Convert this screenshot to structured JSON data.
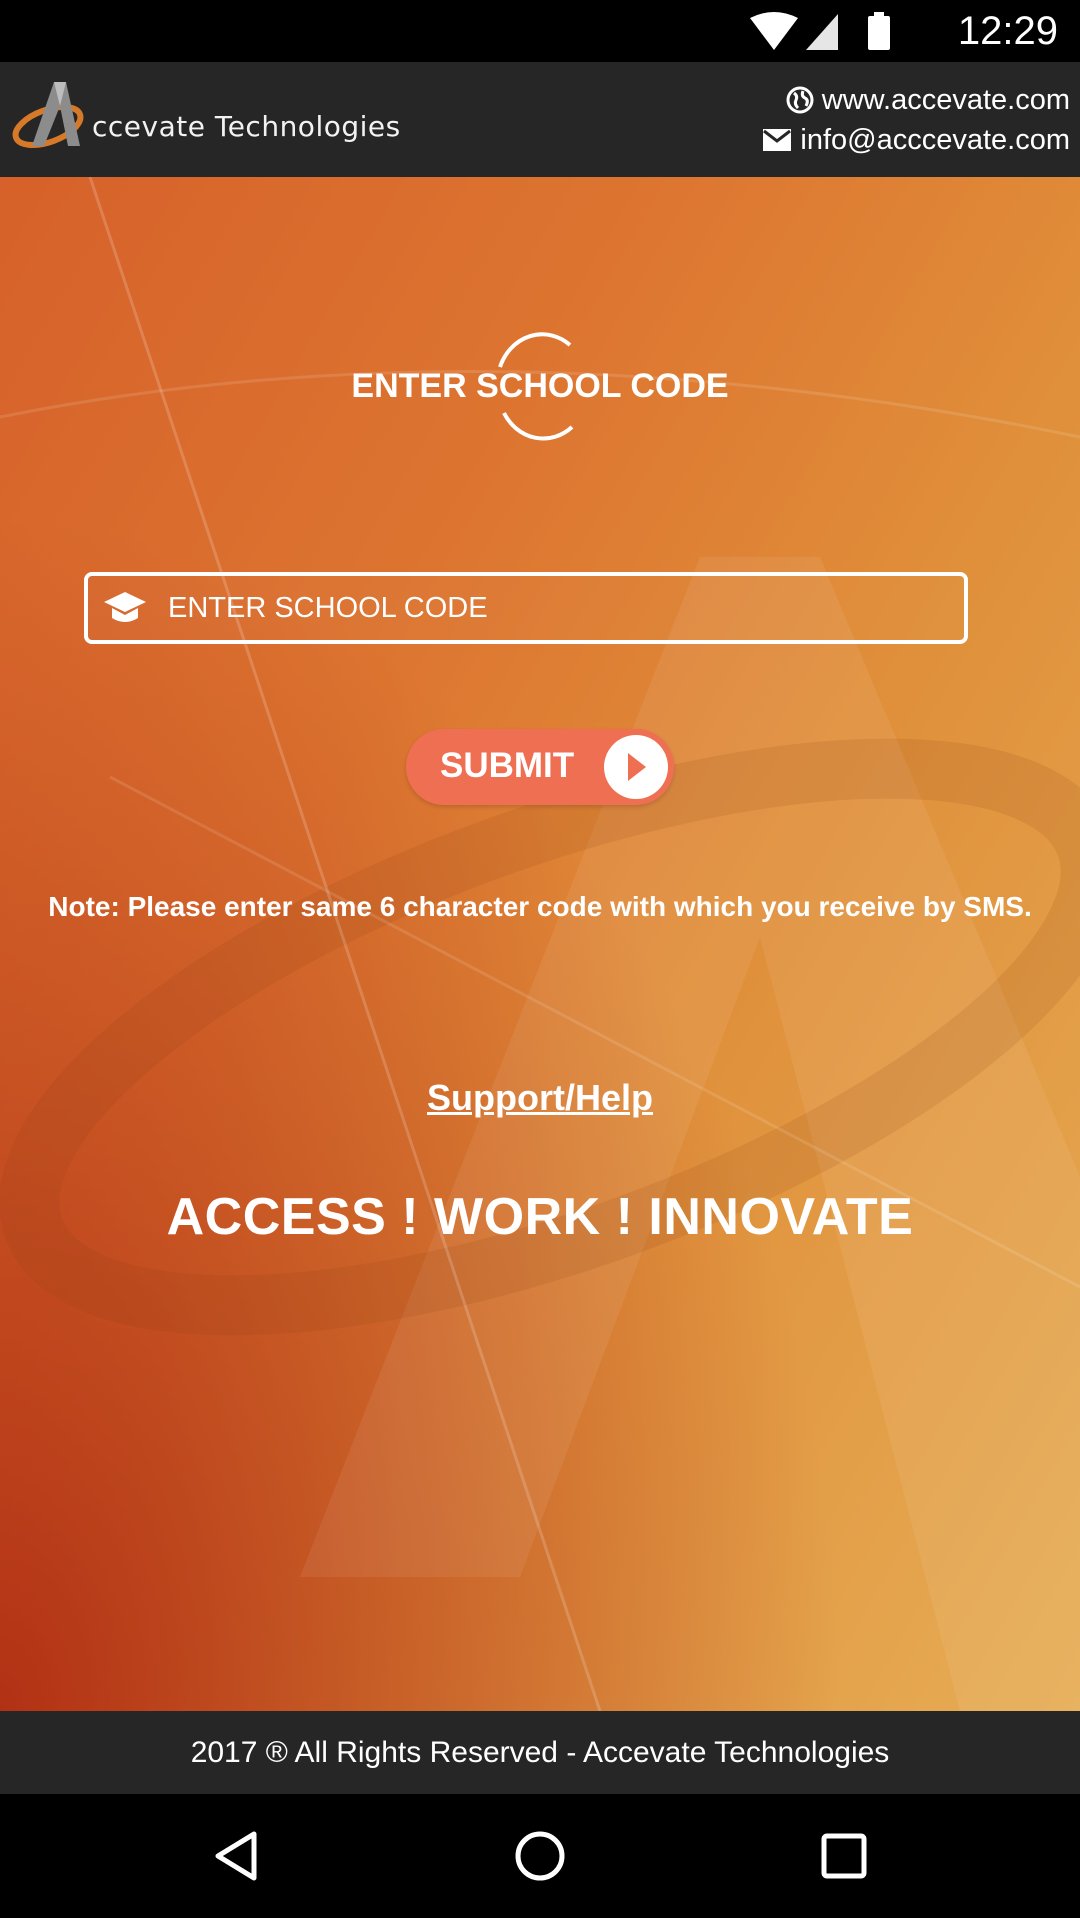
{
  "status_bar": {
    "time": "12:29",
    "icons": [
      "wifi-icon",
      "signal-icon",
      "battery-icon"
    ]
  },
  "header": {
    "brand": "ccevate Technologies",
    "website": "www.accevate.com",
    "email": "info@acccevate.com"
  },
  "main": {
    "title": "ENTER SCHOOL CODE",
    "input_placeholder": "ENTER SCHOOL CODE",
    "input_value": "",
    "submit_label": "SUBMIT",
    "note": "Note: Please enter same 6 character code with which you receive by SMS.",
    "help_link": "Support/Help",
    "tagline": "ACCESS ! WORK ! INNOVATE"
  },
  "footer": {
    "text": "2017 ® All Rights Reserved - Accevate Technologies"
  },
  "nav": [
    "back-icon",
    "home-icon",
    "recents-icon"
  ],
  "colors": {
    "header_bg": "#262626",
    "submit_bg": "#ef6f53",
    "gradient_start": "#d6612a",
    "gradient_end": "#e6ad55"
  }
}
